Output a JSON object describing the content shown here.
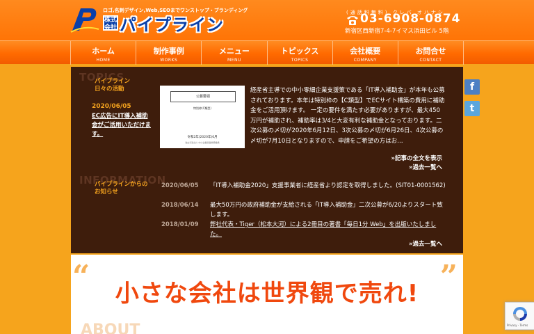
{
  "header": {
    "tagline": "ロゴ,名刺デザイン,Web,SEOまでワンストップ・ブランディング",
    "logo_kaisha": "株式会社",
    "logo_name": "パイプライン",
    "tel_note": "(通話料無料) クレバ オハナシ",
    "tel_number": "03-6908-0874",
    "address": "新宿区西新宿7-4-7イマス浜田ビル 5階"
  },
  "nav": [
    {
      "jp": "ホーム",
      "en": "HOME"
    },
    {
      "jp": "制作事例",
      "en": "WORKS"
    },
    {
      "jp": "メニュー",
      "en": "MENU"
    },
    {
      "jp": "トピックス",
      "en": "TOPICS"
    },
    {
      "jp": "会社概要",
      "en": "COMPANY"
    },
    {
      "jp": "お問合せ",
      "en": "CONTACT"
    }
  ],
  "topics": {
    "label": "TOPICS",
    "subtitle_line1": "パイプライン",
    "subtitle_line2": "日々の活動",
    "date": "2020/06/05",
    "title": "EC広告にIT導入補助金がご活用いただけます。",
    "thumb_heading": "公募要領",
    "thumb_sub": "特別枠(C類型)",
    "thumb_date": "令和2年(2020年)6月",
    "thumb_footnote": "独立行政法人 中小企業基盤整備機構",
    "body": "経産省主導での中小零細企業支援策である「IT導入補助金」が本年も公募されております。本年は特別枠の【C類型】でECサイト構築の費用に補助金をご活用頂けます。 一定の要件を満たす必要がありますが、最大450万円が補助され、補助率は3/4と大変有利な補助金となっております。二次公募の〆切が2020年6月12日、3次公募の〆切が6月26日、4次公募の〆切が7月10日となりますので、申請をご希望の方はお…",
    "read_more": "»記事の全文を表示",
    "past_list": "»過去一覧へ"
  },
  "information": {
    "label": "INFORMATION",
    "subtitle_line1": "パイプラインからの",
    "subtitle_line2": "お知らせ",
    "items": [
      {
        "date": "2020/06/05",
        "text": "「IT導入補助金2020」支援事業者に経産省より認定を取得しました。(SIT01-0001562)"
      },
      {
        "date": "2018/06/14",
        "text": "最大50万円の政府補助金が支給される「IT導入補助金」二次公募が6/20よりスタート致します。"
      },
      {
        "date": "2018/01/09",
        "text": "弊社代表・Tiger（松本大河）による2冊目の著書「毎日1分 Web」を出版いたしました。"
      }
    ],
    "past_list": "»過去一覧へ"
  },
  "banner": {
    "headline": "小さな会社は世界観で売れ!",
    "about_label": "ABOUT"
  },
  "social": {
    "facebook": "f",
    "twitter": "t"
  },
  "recaptcha": {
    "text": "Privacy - Terms"
  }
}
